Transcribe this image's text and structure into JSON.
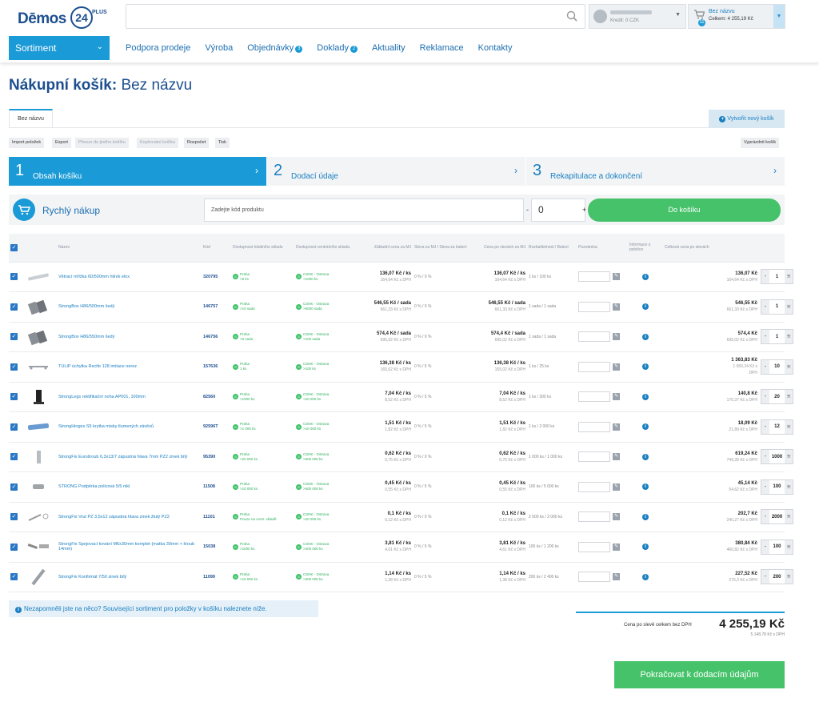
{
  "header": {
    "logo_text": "Dēmos",
    "logo_num": "24",
    "logo_plus": "PLUS",
    "user_credit": "Kredit: 0 CZK",
    "cart_name": "Bez názvu",
    "cart_total": "Celkem: 4 255,19 Kč",
    "cart_count": "11"
  },
  "nav": {
    "sortiment": "Sortiment",
    "items": [
      {
        "label": "Podpora prodeje",
        "badge": ""
      },
      {
        "label": "Výroba",
        "badge": ""
      },
      {
        "label": "Objednávky",
        "badge": "3"
      },
      {
        "label": "Doklady",
        "badge": "2"
      },
      {
        "label": "Aktuality",
        "badge": ""
      },
      {
        "label": "Reklamace",
        "badge": ""
      },
      {
        "label": "Kontakty",
        "badge": ""
      }
    ]
  },
  "page": {
    "title_bold": "Nákupní košík:",
    "title_rest": "Bez názvu",
    "tab": "Bez názvu",
    "new_cart": "Vytvořit nový košík",
    "toolbar": [
      "Import položek",
      "Export",
      "Přesun do jiného košíku",
      "Kopírování košíku",
      "Rozpočet",
      "Tisk"
    ],
    "empty_cart": "Vyprázdnit košík"
  },
  "steps": [
    {
      "num": "1",
      "label": "Obsah košíku"
    },
    {
      "num": "2",
      "label": "Dodací údaje"
    },
    {
      "num": "3",
      "label": "Rekapitulace a dokončení"
    }
  ],
  "quick": {
    "label": "Rychlý nákup",
    "placeholder": "Zadejte kód produktu",
    "minus": "-",
    "qty": "0",
    "plus": "+",
    "button": "Do košíku"
  },
  "table": {
    "headers": [
      "Název",
      "Kód",
      "Dostupnost lokálního skladu",
      "Dostupnost centrálního skladu",
      "Základní cena za MJ",
      "Sleva za MJ / Sleva za balení",
      "Cena po slevách za MJ",
      "Rozbalitelnost / Balení",
      "Poznámka",
      "Informace o položce",
      "Celková cena po slevách"
    ],
    "rows": [
      {
        "name": "Větrací mřížka 60/500mm hliník elox",
        "code": "320795",
        "loc1": "Praha",
        "loc2": ">5 ks",
        "cen1": "CSNK - Ostrava",
        "cen2": ">1000 ks",
        "base": "136,07 Kč / ks",
        "base_vat": "164,64 Kč s DPH",
        "disc": "0 %  /  0 %",
        "price": "136,07 Kč / ks",
        "price_vat": "164,64 Kč s DPH",
        "pack": "1 ks / 100 ks",
        "total": "136,07 Kč",
        "total_vat": "164,64 Kč s DPH",
        "qty": "1"
      },
      {
        "name": "StrongBox H86/500mm šedý",
        "code": "146757",
        "loc1": "Praha",
        "loc2": ">10 sada",
        "cen1": "CSNK - Ostrava",
        "cen2": ">5000 sada",
        "base": "546,55 Kč / sada",
        "base_vat": "661,33 Kč s DPH",
        "disc": "0 %  /  0 %",
        "price": "546,55 Kč / sada",
        "price_vat": "661,33 Kč s DPH",
        "pack": "1 sada / 1 sada",
        "total": "546,55 Kč",
        "total_vat": "661,33 Kč s DPH",
        "qty": "1"
      },
      {
        "name": "StrongBox H86/550mm šedý",
        "code": "146756",
        "loc1": "Praha",
        "loc2": ">5 sada",
        "cen1": "CSNK - Ostrava",
        "cen2": ">100 sada",
        "base": "574,4 Kč / sada",
        "base_vat": "695,02 Kč s DPH",
        "disc": "0 %  /  0 %",
        "price": "574,4 Kč / sada",
        "price_vat": "695,02 Kč s DPH",
        "pack": "1 sada / 1 sada",
        "total": "574,4 Kč",
        "total_vat": "695,02 Kč s DPH",
        "qty": "1"
      },
      {
        "name": "TULIP úchytka Recife 128 imitace nerez",
        "code": "157636",
        "loc1": "Praha",
        "loc2": "1 ks",
        "cen1": "CSNK - Ostrava",
        "cen2": ">100 ks",
        "base": "136,38 Kč / ks",
        "base_vat": "165,02 Kč s DPH",
        "disc": "0 %  /  5 %",
        "price": "136,38 Kč / ks",
        "price_vat": "165,02 Kč s DPH",
        "pack": "1 ks / 25 ks",
        "total": "1 363,83 Kč",
        "total_vat": "1 650,24 Kč s DPH",
        "qty": "10"
      },
      {
        "name": "StrongLegs rektifikační noha AP001, 100mm",
        "code": "82560",
        "loc1": "Praha",
        "loc2": ">1000 ks",
        "cen1": "CSNK - Ostrava",
        "cen2": ">20 000 ks",
        "base": "7,04 Kč / ks",
        "base_vat": "8,52 Kč s DPH",
        "disc": "0 %  /  5 %",
        "price": "7,04 Kč / ks",
        "price_vat": "8,52 Kč s DPH",
        "pack": "1 ks / 300 ks",
        "total": "140,8 Kč",
        "total_vat": "170,37 Kč s DPH",
        "qty": "20"
      },
      {
        "name": "StrongHinges S5 krytka misky tlumených závěsů",
        "code": "92596T",
        "loc1": "Praha",
        "loc2": ">1 000 ks",
        "cen1": "CSNK - Ostrava",
        "cen2": ">10 000 ks",
        "base": "1,51 Kč / ks",
        "base_vat": "1,82 Kč s DPH",
        "disc": "0 %  /  5 %",
        "price": "1,51 Kč / ks",
        "price_vat": "1,82 Kč s DPH",
        "pack": "1 ks / 2 000 ks",
        "total": "18,09 Kč",
        "total_vat": "21,89 Kč s DPH",
        "qty": "12"
      },
      {
        "name": "StrongFix Eurošroub 6,3x13/7 zápustná hlava 7mm PZ2 zinek bílý",
        "code": "95390",
        "loc1": "Praha",
        "loc2": ">20 000 ks",
        "cen1": "CSNK - Ostrava",
        "cen2": ">500 000 ks",
        "base": "0,62 Kč / ks",
        "base_vat": "0,75 Kč s DPH",
        "disc": "0 %  /  0 %",
        "price": "0,62 Kč / ks",
        "price_vat": "0,75 Kč s DPH",
        "pack": "1 000 ks / 1 000 ks",
        "total": "619,24 Kč",
        "total_vat": "749,28 Kč s DPH",
        "qty": "1000"
      },
      {
        "name": "STRONG Podpěrka policová 5/5 nikl",
        "code": "11508",
        "loc1": "Praha",
        "loc2": ">10 000 ks",
        "cen1": "CSNK - Ostrava",
        "cen2": ">500 000 ks",
        "base": "0,45 Kč / ks",
        "base_vat": "0,55 Kč s DPH",
        "disc": "0 %  /  5 %",
        "price": "0,45 Kč / ks",
        "price_vat": "0,55 Kč s DPH",
        "pack": "100 ks / 5 000 ks",
        "total": "45,14 Kč",
        "total_vat": "54,62 Kč s DPH",
        "qty": "100"
      },
      {
        "name": "StrongFix Vrut PZ 3,5x12 zápustná hlava zinek žlutý PZ2",
        "code": "11101",
        "loc1": "Praha",
        "loc2": "Pouze na centr. skladě",
        "cen1": "CSNK - Ostrava",
        "cen2": ">20 000 ks",
        "base": "0,1 Kč / ks",
        "base_vat": "0,12 Kč s DPH",
        "disc": "0 %  /  0 %",
        "price": "0,1 Kč / ks",
        "price_vat": "0,12 Kč s DPH",
        "pack": "2 000 ks / 2 000 ks",
        "total": "202,7 Kč",
        "total_vat": "245,27 Kč s DPH",
        "qty": "2000"
      },
      {
        "name": "StrongFix Spojovací kování M6x30mm komplet (matka 30mm + šroub 14mm)",
        "code": "15038",
        "loc1": "Praha",
        "loc2": ">1000 ks",
        "cen1": "CSNK - Ostrava",
        "cen2": ">200 000 ks",
        "base": "3,81 Kč / ks",
        "base_vat": "4,61 Kč s DPH",
        "disc": "0 %  /  5 %",
        "price": "3,81 Kč / ks",
        "price_vat": "4,61 Kč s DPH",
        "pack": "100 ks / 1 200 ks",
        "total": "380,84 Kč",
        "total_vat": "460,82 Kč s DPH",
        "qty": "100"
      },
      {
        "name": "StrongFix Konfirmát 7/50 zinek bílý",
        "code": "11099",
        "loc1": "Praha",
        "loc2": ">10 000 ks",
        "cen1": "CSNK - Ostrava",
        "cen2": ">300 000 ks",
        "base": "1,14 Kč / ks",
        "base_vat": "1,38 Kč s DPH",
        "disc": "0 %  /  5 %",
        "price": "1,14 Kč / ks",
        "price_vat": "1,38 Kč s DPH",
        "pack": "200 ks / 2 400 ks",
        "total": "227,52 Kč",
        "total_vat": "275,3 Kč s DPH",
        "qty": "200"
      }
    ]
  },
  "footer": {
    "forgot": "Nezapomněli jste na něco? Související sortiment pro položky v košíku naleznete níže.",
    "total_label": "Cena po slevě celkem bez DPH",
    "total_value": "4 255,19 Kč",
    "total_vat": "5 148,78 Kč s DPH",
    "continue": "Pokračovat k dodacím údajům"
  },
  "colors": {
    "accent": "#1a9ad6",
    "green": "#46c36a",
    "title": "#1d4f8f"
  }
}
